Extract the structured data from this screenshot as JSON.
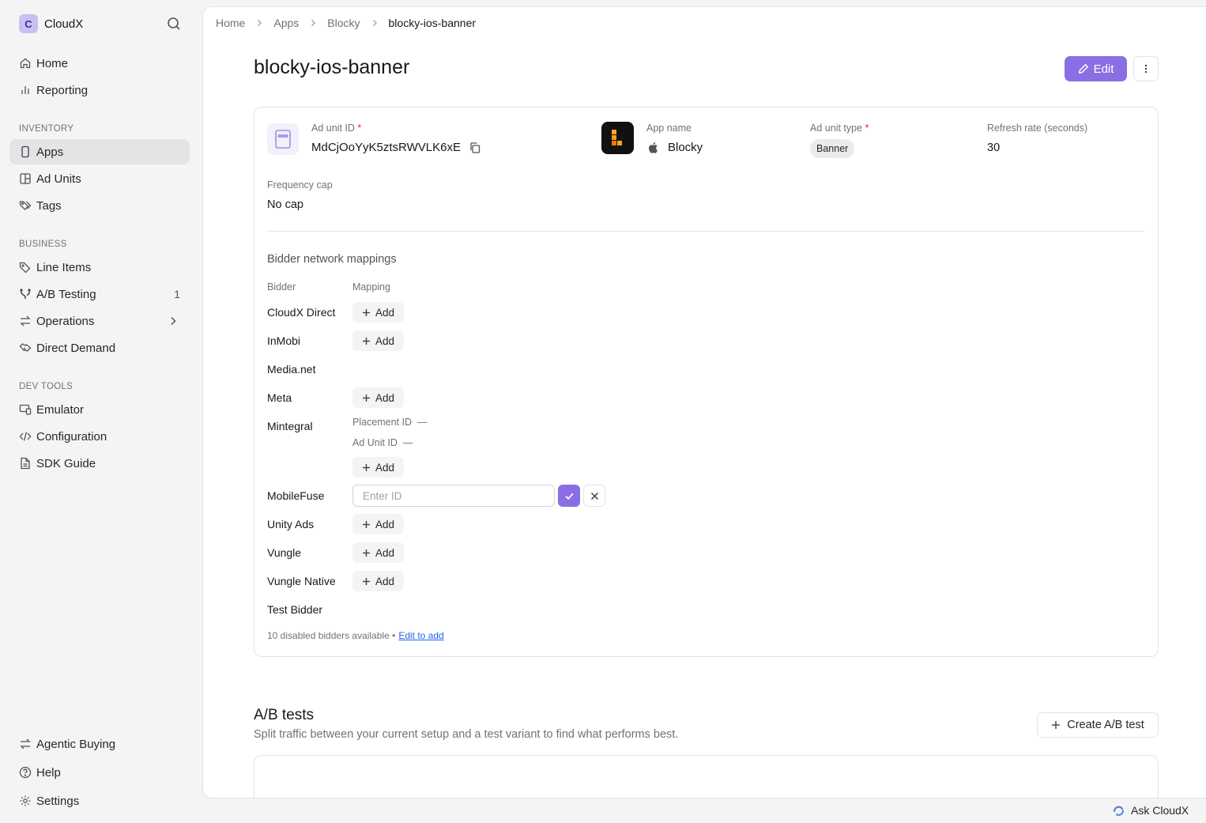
{
  "brand": {
    "initial": "C",
    "name": "CloudX"
  },
  "sidebar": {
    "top_items": [
      {
        "label": "Home",
        "icon": "home-icon"
      },
      {
        "label": "Reporting",
        "icon": "bar-chart-icon"
      }
    ],
    "sections": {
      "inventory": "INVENTORY",
      "business": "BUSINESS",
      "dev_tools": "DEV TOOLS"
    },
    "inventory_items": [
      {
        "label": "Apps",
        "icon": "phone-icon",
        "active": true
      },
      {
        "label": "Ad Units",
        "icon": "layout-icon"
      },
      {
        "label": "Tags",
        "icon": "tags-icon"
      }
    ],
    "business_items": [
      {
        "label": "Line Items",
        "icon": "tag-icon"
      },
      {
        "label": "A/B Testing",
        "icon": "split-icon",
        "count": "1"
      },
      {
        "label": "Operations",
        "icon": "arrows-icon"
      },
      {
        "label": "Direct Demand",
        "icon": "handshake-icon"
      }
    ],
    "dev_items": [
      {
        "label": "Emulator",
        "icon": "devices-icon"
      },
      {
        "label": "Configuration",
        "icon": "code-icon"
      },
      {
        "label": "SDK Guide",
        "icon": "file-icon"
      }
    ],
    "bottom_items": [
      {
        "label": "Agentic Buying",
        "icon": "arrows-icon"
      },
      {
        "label": "Help",
        "icon": "help-icon"
      },
      {
        "label": "Settings",
        "icon": "gear-icon"
      }
    ]
  },
  "breadcrumb": [
    "Home",
    "Apps",
    "Blocky",
    "blocky-ios-banner"
  ],
  "page": {
    "title": "blocky-ios-banner",
    "edit_label": "Edit"
  },
  "details": {
    "ad_unit_id_label": "Ad unit ID",
    "ad_unit_id": "MdCjOoYyK5ztsRWVLK6xE",
    "app_name_label": "App name",
    "app_name": "Blocky",
    "ad_unit_type_label": "Ad unit type",
    "ad_unit_type": "Banner",
    "refresh_label": "Refresh rate (seconds)",
    "refresh_value": "30",
    "frequency_label": "Frequency cap",
    "frequency_value": "No cap",
    "required_mark": "*"
  },
  "mappings": {
    "heading": "Bidder network mappings",
    "col_bidder": "Bidder",
    "col_mapping": "Mapping",
    "add_label": "Add",
    "bidders": [
      "CloudX Direct",
      "InMobi",
      "Media.net",
      "Meta",
      "Mintegral",
      "MobileFuse",
      "Unity Ads",
      "Vungle",
      "Vungle Native",
      "Test Bidder"
    ],
    "mintegral_fields": [
      "Placement ID",
      "Ad Unit ID"
    ],
    "empty_value": "—",
    "input_placeholder": "Enter ID",
    "input_value": "",
    "footnote": "10 disabled bidders available •",
    "footnote_link": "Edit to add"
  },
  "ab_tests": {
    "title": "A/B tests",
    "subtitle": "Split traffic between your current setup and a test variant to find what performs best.",
    "create_label": "Create A/B test"
  },
  "assistant": {
    "label": "Ask CloudX"
  },
  "colors": {
    "accent": "#8b6ee3",
    "link": "#2563eb",
    "required": "#dc2626"
  }
}
